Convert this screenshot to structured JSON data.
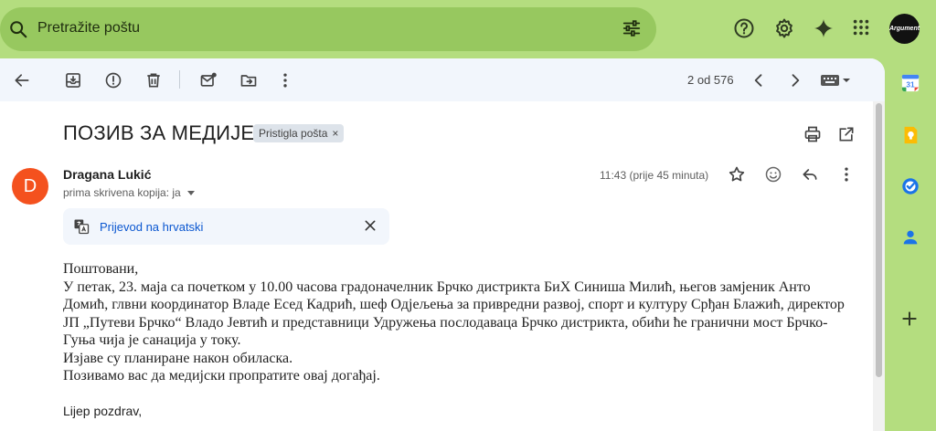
{
  "search": {
    "placeholder": "Pretražite poštu"
  },
  "top_bar": {
    "avatar_text": "Argument"
  },
  "toolbar": {
    "pager_text": "2 od 576"
  },
  "email": {
    "subject": "ПОЗИВ ЗА МЕДИЈЕ",
    "label": "Pristigla pošta",
    "label_close": "×",
    "sender_initial": "D",
    "sender_name": "Dragana Lukić",
    "recipient_text": "prima skrivena kopija: ja",
    "time": "11:43 (prije 45 minuta)",
    "translate_text": "Prijevod na hrvatski",
    "body_lines": [
      "Поштовани,",
      "У петак, 23. маја са почетком у 10.00 часова градоначелник Брчко дистрикта БиХ Синиша Милић, његов замјеник Анто",
      "Домић, глвни координатор Владе Есед Кадрић, шеф Одјељења за привредни развој, спорт и културу Срђан Блажић, директор",
      "ЈП „Путеви Брчко“ Владо Јевтић и представници Удружења послодаваца Брчко дистрикта, обићи ће гранични мост Брчко-",
      "Гуња чија је санација у току.",
      "Изјаве су планиране након обиласка.",
      "Позивамо вас да медијски пропратите овај догађај."
    ],
    "signoff": "Lijep pozdrav,"
  },
  "colors": {
    "page_bg": "#b4dd7f",
    "search_bg": "#97c85f",
    "panel_bg": "#f2f6fc",
    "sender_avatar": "#f4511e",
    "link_blue": "#0b57d0"
  }
}
